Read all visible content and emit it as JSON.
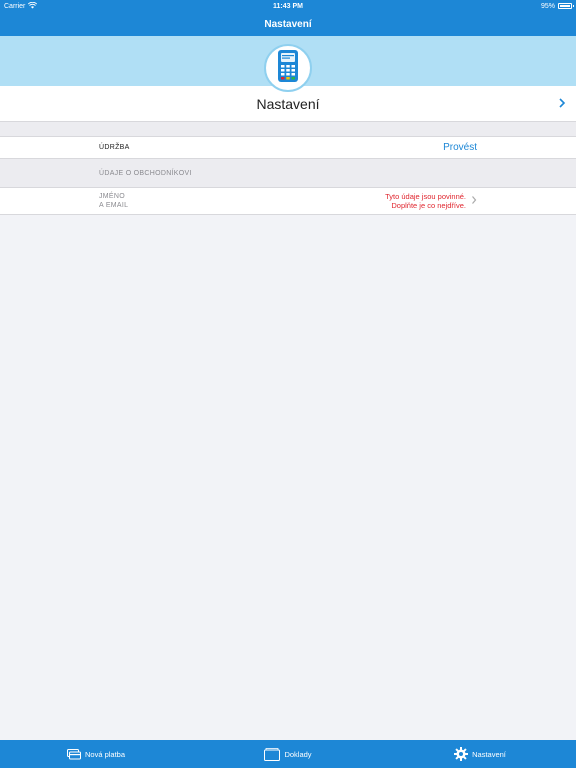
{
  "status_bar": {
    "carrier": "Carrier",
    "time": "11:43 PM",
    "battery": "95%"
  },
  "nav": {
    "title": "Nastavení"
  },
  "profile": {
    "title": "Nastavení",
    "icon": "card-terminal-icon"
  },
  "maintenance": {
    "label": "ÚDRŽBA",
    "action": "Provést"
  },
  "merchant_section": {
    "header": "ÚDAJE O OBCHODNÍKOVI",
    "row": {
      "label_line1": "JMÉNO",
      "label_line2": "A EMAIL",
      "warning_line1": "Tyto údaje jsou povinné.",
      "warning_line2": "Doplňte je co nejdříve."
    }
  },
  "tabs": [
    {
      "label": "Nová platba",
      "icon": "payment-icon"
    },
    {
      "label": "Doklady",
      "icon": "receipts-icon"
    },
    {
      "label": "Nastavení",
      "icon": "gear-icon"
    }
  ],
  "colors": {
    "primary": "#1d87d6",
    "hero": "#b0dff5",
    "warning": "#e0262f",
    "background": "#f2f3f7"
  }
}
